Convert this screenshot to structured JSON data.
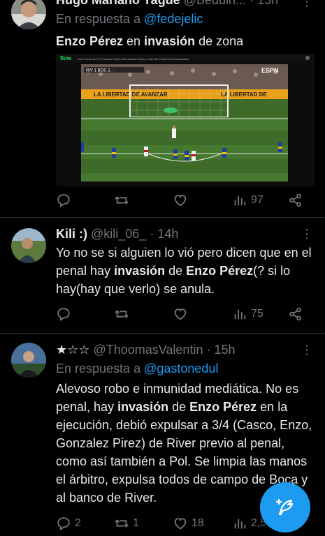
{
  "colors": {
    "accent": "#1d9bf0",
    "background": "#000000",
    "muted": "#71767b"
  },
  "tweets": [
    {
      "name": "Hugo Mariano Yague",
      "handle": "@Beduin...",
      "time": "15h",
      "reply_prefix": "En respuesta a",
      "reply_to": "@fedejelic",
      "text": {
        "a": "Enzo Pérez",
        "b": " en ",
        "c": "invasión",
        "d": " de zona"
      },
      "media": {
        "app_logo": "flow",
        "nav": "Inicio  Guía de TV  Películas  Series  Kids  Adultos  Radio y más  Mis Contenidos  Destacados",
        "banner": "LA LIBERTAD DE AVANZAR",
        "banner2": "LA LIBERTAD DE",
        "broadcaster": "ESPN",
        "score": "RIV 1  BOC 1"
      },
      "actions": {
        "replies": "",
        "retweets": "",
        "likes": "",
        "views": "97"
      }
    },
    {
      "name": "Kili :)",
      "handle": "@kili_06_",
      "time": "14h",
      "text": {
        "a": "Yo no se si alguien lo vió pero dicen que en el penal hay ",
        "b": "invasión",
        "c": " de ",
        "d": "Enzo Pérez",
        "e": "(? si lo hay(hay que verlo) se anula."
      },
      "actions": {
        "replies": "",
        "retweets": "",
        "likes": "",
        "views": "75"
      }
    },
    {
      "name": "★☆☆",
      "handle": "@ThoomasValentin",
      "time": "15h",
      "reply_prefix": "En respuesta a",
      "reply_to": "@gastonedul",
      "text": {
        "a": "Alevoso robo e inmunidad mediática. No es penal, hay ",
        "b": "invasión",
        "c": " de ",
        "d": "Enzo Pérez",
        "e": " en la ejecución, debió expulsar a 3/4 (Casco, Enzo, Gonzalez Pirez) de River previo al penal, como así también a Pol. Se limpia las manos el árbitro, expulsa todos de campo de Boca y al banco de River."
      },
      "actions": {
        "replies": "2",
        "retweets": "1",
        "likes": "18",
        "views": "2,5..."
      }
    }
  ],
  "icons": {
    "reply": "reply-icon",
    "retweet": "retweet-icon",
    "like": "heart-icon",
    "views": "views-icon",
    "share": "share-icon",
    "compose": "compose-feather-icon"
  }
}
